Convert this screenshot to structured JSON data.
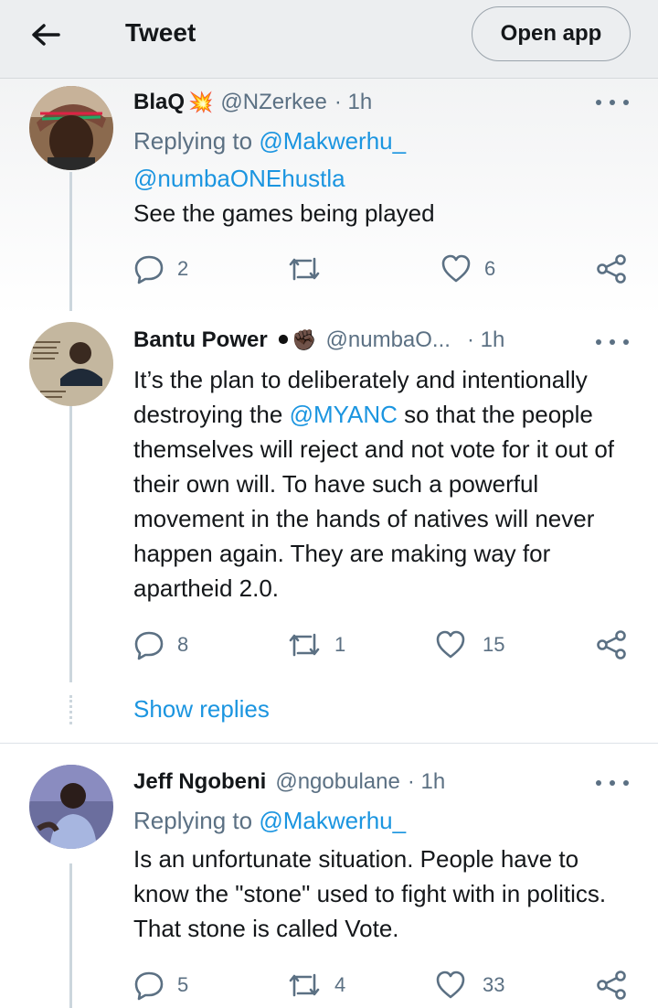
{
  "header": {
    "title": "Tweet",
    "open_app_label": "Open app"
  },
  "tweets": [
    {
      "name": "BlaQ",
      "name_emoji": "💥",
      "handle": "@NZerkee",
      "time": "· 1h",
      "replying_prefix": "Replying to",
      "replying_to": "@Makwerhu_",
      "mention_line": "@numbaONEhustla",
      "text": "See the games being played",
      "replies": "2",
      "retweets": "",
      "likes": "6"
    },
    {
      "name": "Bantu Power",
      "name_emoji": "⚫✊🏿",
      "handle": "@numbaO...",
      "time": "· 1h",
      "text_before": "It’s the plan to deliberately and intentionally destroying the ",
      "text_mention": "@MYANC",
      "text_after": " so that the people themselves will reject and not vote for it out of their own will. To have such a powerful movement in the hands of natives will never happen again. They are making way for apartheid 2.0.",
      "replies": "8",
      "retweets": "1",
      "likes": "15",
      "show_replies_label": "Show replies"
    },
    {
      "name": "Jeff Ngobeni",
      "handle": "@ngobulane",
      "time": "· 1h",
      "replying_prefix": "Replying to",
      "replying_to": "@Makwerhu_",
      "text": "Is an unfortunate situation. People have to know the \"stone\" used to fight with in politics. That stone is called Vote.",
      "replies": "5",
      "retweets": "4",
      "likes": "33"
    }
  ],
  "colors": {
    "link": "#1b95e0",
    "secondary_text": "#5b7083",
    "header_bg": "#eceef0"
  }
}
